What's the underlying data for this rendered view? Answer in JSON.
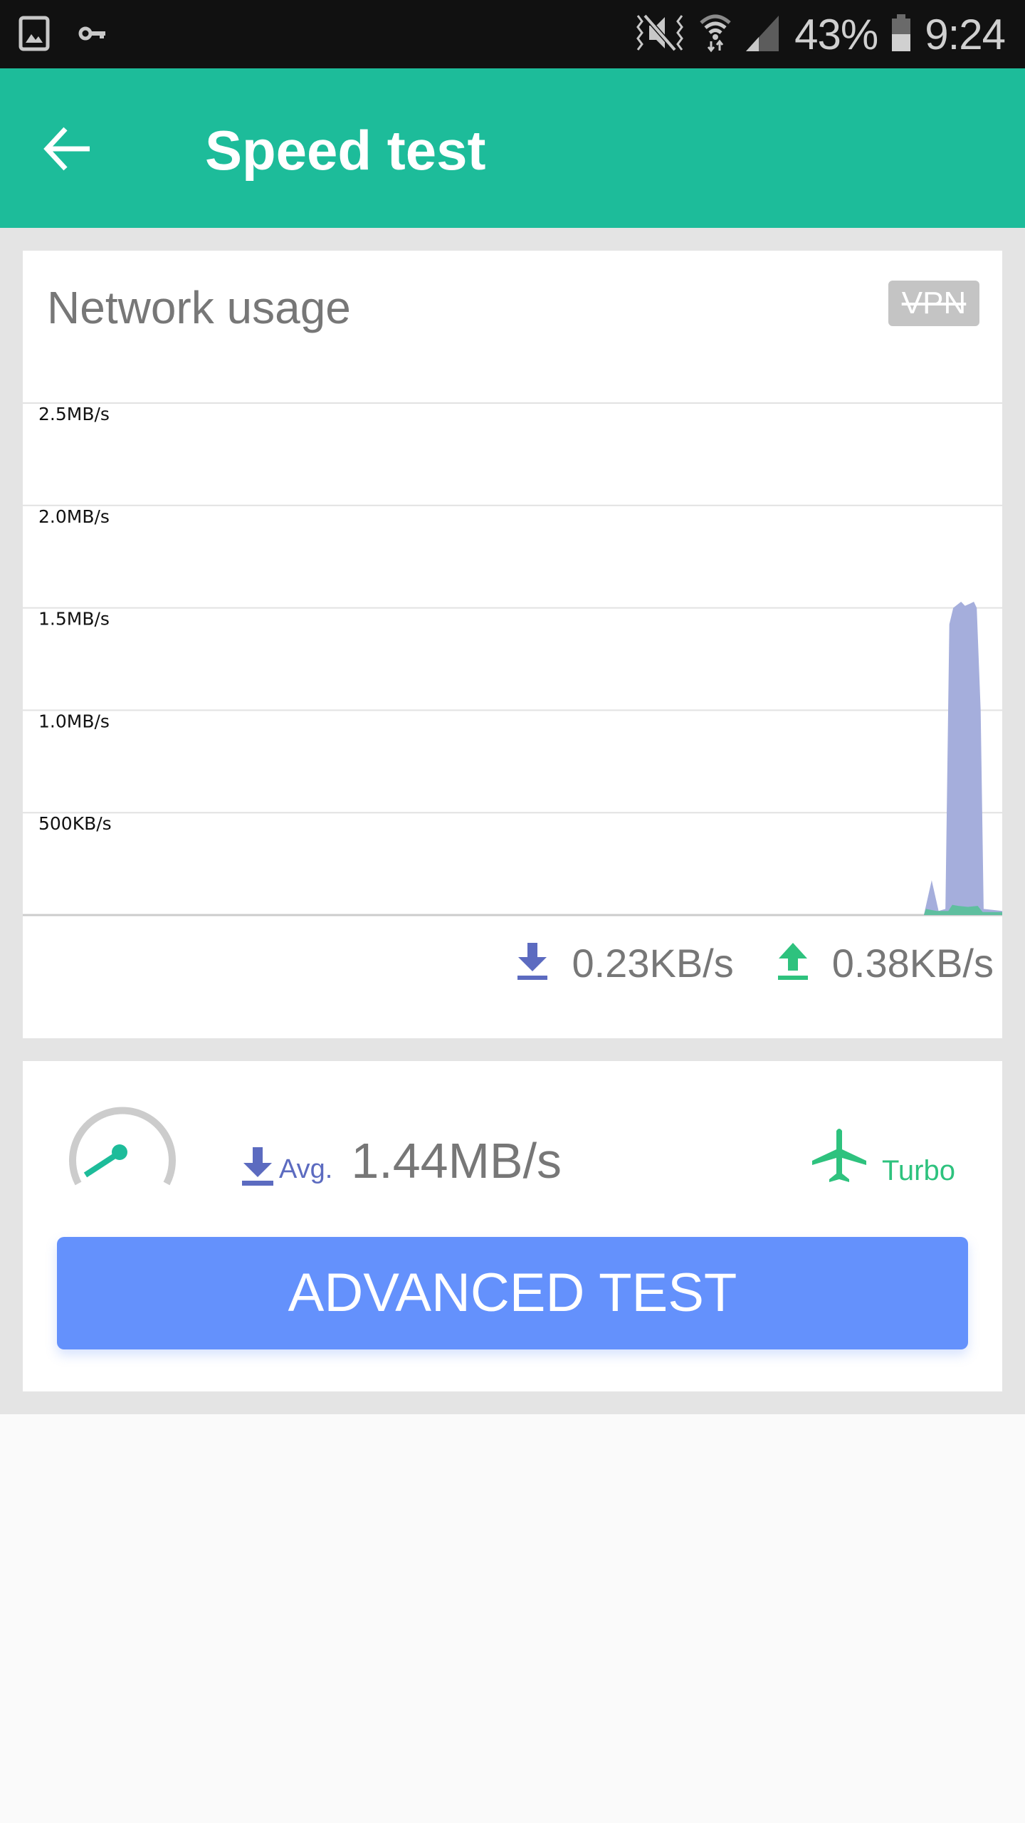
{
  "status_bar": {
    "icons_left": [
      "gallery-icon",
      "vpn-key-icon"
    ],
    "icons_right": [
      "mute-vibrate-icon",
      "wifi-icon",
      "signal-icon"
    ],
    "battery": "43%",
    "time": "9:24"
  },
  "app_bar": {
    "title": "Speed test",
    "back_icon": "arrow-left-icon"
  },
  "network_card": {
    "title": "Network usage",
    "vpn_badge": "VPN",
    "download_speed": "0.23KB/s",
    "upload_speed": "0.38KB/s",
    "download_icon": "download-icon",
    "upload_icon": "upload-icon"
  },
  "test_card": {
    "gauge_icon": "speedometer-icon",
    "avg_label": "Avg.",
    "avg_value": "1.44MB/s",
    "turbo_label": "Turbo",
    "turbo_icon": "airplane-icon",
    "advanced_button": "ADVANCED TEST"
  },
  "colors": {
    "primary": "#1dbc9a",
    "download": "#5c6bc0",
    "download_fill": "#a5aedc",
    "upload": "#2ec27e",
    "upload_fill": "#5fbf9f",
    "button": "#6491fc"
  },
  "chart_data": {
    "type": "area",
    "title": "Network usage",
    "xlabel": "",
    "ylabel": "",
    "y_unit": "MB/s",
    "ylim": [
      0,
      2.5
    ],
    "yticks": [
      0.5,
      1.0,
      1.5,
      2.0,
      2.5
    ],
    "ytick_labels": [
      "500KB/s",
      "1.0MB/s",
      "1.5MB/s",
      "2.0MB/s",
      "2.5MB/s"
    ],
    "grid": true,
    "x_points": 100,
    "series": [
      {
        "name": "Download",
        "color": "#a5aedc",
        "values": [
          [
            0,
            0
          ],
          [
            92.0,
            0
          ],
          [
            92.8,
            0.17
          ],
          [
            93.5,
            0.02
          ],
          [
            94.2,
            0.03
          ],
          [
            94.6,
            1.42
          ],
          [
            95.0,
            1.5
          ],
          [
            95.8,
            1.53
          ],
          [
            96.2,
            1.51
          ],
          [
            96.7,
            1.52
          ],
          [
            97.1,
            1.53
          ],
          [
            97.4,
            1.5
          ],
          [
            97.8,
            1.0
          ],
          [
            98.1,
            0.03
          ],
          [
            100,
            0.02
          ]
        ]
      },
      {
        "name": "Upload",
        "color": "#5fbf9f",
        "values": [
          [
            0,
            0
          ],
          [
            92.0,
            0
          ],
          [
            92.2,
            0.03
          ],
          [
            93.3,
            0.02
          ],
          [
            94.5,
            0.02
          ],
          [
            94.9,
            0.05
          ],
          [
            95.5,
            0.045
          ],
          [
            96.5,
            0.04
          ],
          [
            97.5,
            0.045
          ],
          [
            98.0,
            0.015
          ],
          [
            100,
            0.015
          ]
        ]
      }
    ]
  }
}
